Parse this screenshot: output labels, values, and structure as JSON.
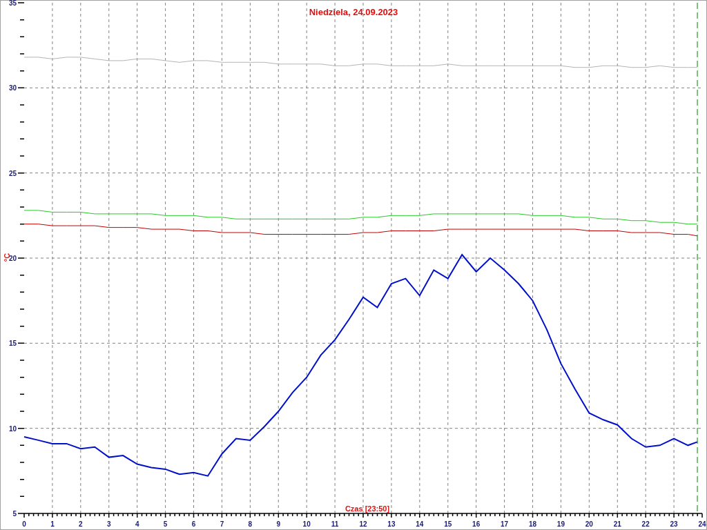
{
  "chart": {
    "chart_data": {
      "type": "line",
      "title": "Niedziela, 24.09.2023",
      "xlabel": "Czas [23:50]",
      "ylabel": "°C",
      "x": [
        0,
        0.5,
        1,
        1.5,
        2,
        2.5,
        3,
        3.5,
        4,
        4.5,
        5,
        5.5,
        6,
        6.5,
        7,
        7.5,
        8,
        8.5,
        9,
        9.5,
        10,
        10.5,
        11,
        11.5,
        12,
        12.5,
        13,
        13.5,
        14,
        14.5,
        15,
        15.5,
        16,
        16.5,
        17,
        17.5,
        18,
        18.5,
        19,
        19.5,
        20,
        20.5,
        21,
        21.5,
        22,
        22.5,
        23,
        23.5,
        23.83
      ],
      "series": [
        {
          "color": "#b4b4b4",
          "values": [
            31.8,
            31.8,
            31.7,
            31.8,
            31.8,
            31.7,
            31.6,
            31.6,
            31.7,
            31.7,
            31.6,
            31.5,
            31.6,
            31.6,
            31.5,
            31.5,
            31.5,
            31.5,
            31.4,
            31.4,
            31.4,
            31.4,
            31.3,
            31.3,
            31.4,
            31.4,
            31.3,
            31.3,
            31.3,
            31.3,
            31.4,
            31.3,
            31.3,
            31.3,
            31.3,
            31.3,
            31.3,
            31.3,
            31.3,
            31.2,
            31.2,
            31.3,
            31.3,
            31.2,
            31.2,
            31.3,
            31.2,
            31.2,
            31.2
          ]
        },
        {
          "color": "#22cc22",
          "values": [
            22.8,
            22.8,
            22.7,
            22.7,
            22.7,
            22.6,
            22.6,
            22.6,
            22.6,
            22.6,
            22.5,
            22.5,
            22.5,
            22.4,
            22.4,
            22.3,
            22.3,
            22.3,
            22.3,
            22.3,
            22.3,
            22.3,
            22.3,
            22.3,
            22.4,
            22.4,
            22.5,
            22.5,
            22.5,
            22.6,
            22.6,
            22.6,
            22.6,
            22.6,
            22.6,
            22.6,
            22.5,
            22.5,
            22.5,
            22.4,
            22.4,
            22.3,
            22.3,
            22.2,
            22.2,
            22.1,
            22.1,
            22.0,
            22.0
          ]
        },
        {
          "color": "#c00000",
          "values": [
            22.0,
            22.0,
            21.9,
            21.9,
            21.9,
            21.9,
            21.8,
            21.8,
            21.8,
            21.7,
            21.7,
            21.7,
            21.6,
            21.6,
            21.5,
            21.5,
            21.5,
            21.4,
            21.4,
            21.4,
            21.4,
            21.4,
            21.4,
            21.4,
            21.5,
            21.5,
            21.6,
            21.6,
            21.6,
            21.6,
            21.7,
            21.7,
            21.7,
            21.7,
            21.7,
            21.7,
            21.7,
            21.7,
            21.7,
            21.7,
            21.6,
            21.6,
            21.6,
            21.5,
            21.5,
            21.5,
            21.4,
            21.4,
            21.3
          ]
        },
        {
          "color": "#0010c8",
          "values": [
            9.5,
            9.3,
            9.1,
            9.1,
            8.8,
            8.9,
            8.3,
            8.4,
            7.9,
            7.7,
            7.6,
            7.3,
            7.4,
            7.2,
            8.5,
            9.4,
            9.3,
            10.1,
            11.0,
            12.1,
            13.0,
            14.3,
            15.2,
            16.4,
            17.7,
            17.1,
            18.5,
            18.8,
            17.8,
            19.3,
            18.8,
            20.2,
            19.2,
            20.0,
            19.3,
            18.5,
            17.5,
            15.8,
            13.8,
            12.3,
            10.9,
            10.5,
            10.2,
            9.4,
            8.9,
            9.0,
            9.4,
            9.0,
            9.2
          ]
        }
      ],
      "xlim": [
        0,
        24
      ],
      "ylim": [
        5,
        35
      ],
      "xticks": [
        0,
        1,
        2,
        3,
        4,
        5,
        6,
        7,
        8,
        9,
        10,
        11,
        12,
        13,
        14,
        15,
        16,
        17,
        18,
        19,
        20,
        21,
        22,
        23,
        24
      ],
      "yticks": [
        5,
        10,
        15,
        20,
        25,
        30,
        35
      ],
      "grid": true,
      "ref_lines": [
        {
          "axis": "x",
          "value": 23.83,
          "color": "#008000"
        }
      ]
    }
  }
}
